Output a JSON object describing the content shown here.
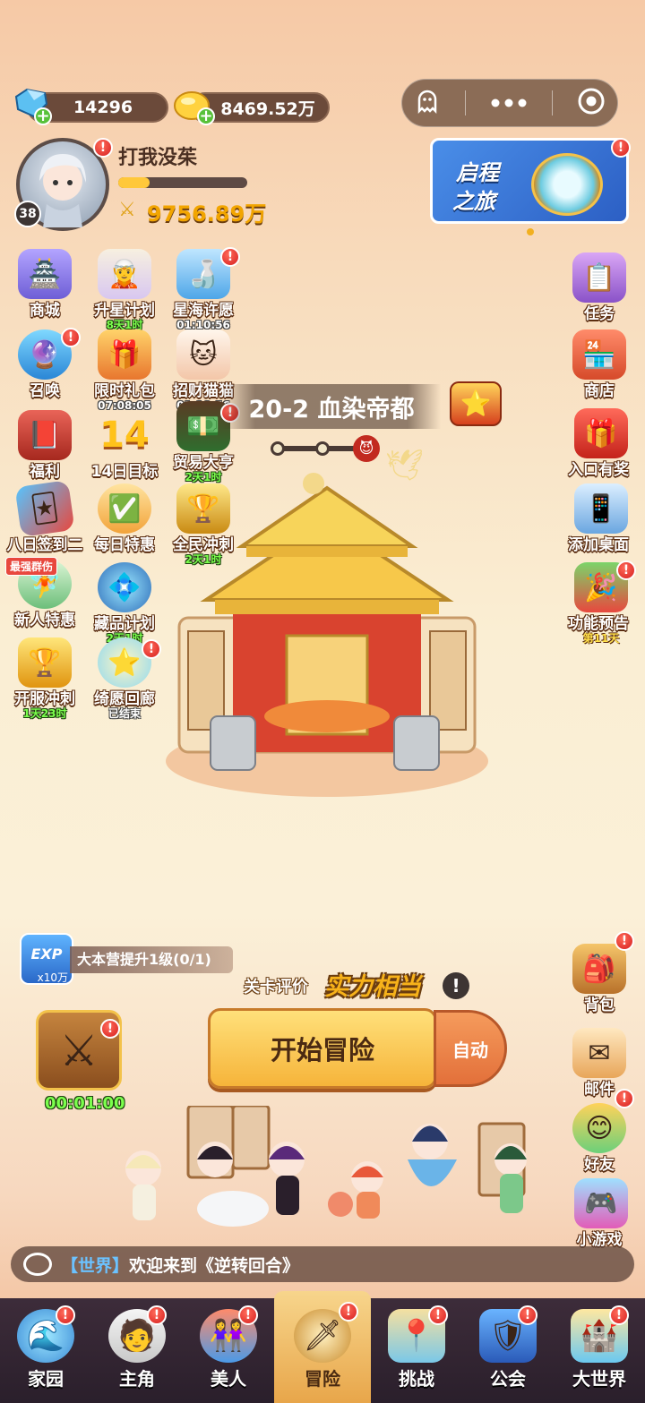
{
  "currency": {
    "gems": "14296",
    "gold": "8469.52万"
  },
  "player": {
    "name": "打我没茱",
    "level": "38",
    "power": "9756.89万"
  },
  "banner": {
    "title_line1": "启程",
    "title_line2": "之旅"
  },
  "left_grid": [
    {
      "label": "商城",
      "timer": ""
    },
    {
      "label": "升星计划",
      "timer": "8天1时"
    },
    {
      "label": "星海许愿",
      "timer": "01:10:56"
    },
    {
      "label": "召唤",
      "timer": ""
    },
    {
      "label": "限时礼包",
      "timer": "07:08:05"
    },
    {
      "label": "招财猫猫",
      "timer": "01:10:56"
    },
    {
      "label": "福利",
      "timer": ""
    },
    {
      "label": "14日目标",
      "timer": ""
    },
    {
      "label": "贸易大亨",
      "timer": "2天1时"
    },
    {
      "label": "八日签到二",
      "timer": ""
    },
    {
      "label": "每日特惠",
      "timer": ""
    },
    {
      "label": "全民冲刺",
      "timer": "2天1时"
    },
    {
      "label": "新人特惠",
      "timer": "",
      "tag": "最强群伤"
    },
    {
      "label": "藏品计划",
      "timer": "2天1时"
    },
    {
      "label": "开服冲刺",
      "timer": "1天23时"
    },
    {
      "label": "绮愿回廊",
      "timer": "已结束"
    }
  ],
  "right_col": [
    {
      "label": "任务",
      "timer": ""
    },
    {
      "label": "商店",
      "timer": ""
    },
    {
      "label": "入口有奖",
      "timer": ""
    },
    {
      "label": "添加桌面",
      "timer": ""
    },
    {
      "label": "功能预告",
      "timer": "第11天"
    }
  ],
  "right_lower": [
    {
      "label": "背包"
    },
    {
      "label": "邮件"
    },
    {
      "label": "好友"
    },
    {
      "label": "小游戏"
    }
  ],
  "stage": {
    "title": "20-2 血染帝都"
  },
  "quest": {
    "exp_badge": "EXP",
    "exp_amount": "x10万",
    "text": "大本营提升1级(0/1)"
  },
  "rating": {
    "label": "关卡评价",
    "value": "实力相当"
  },
  "battle": {
    "start_label": "开始冒险",
    "auto_label": "自动",
    "idle_timer": "00:01:00"
  },
  "chat": {
    "channel": "【世界】",
    "message": "欢迎来到《逆转回合》"
  },
  "nav": [
    {
      "label": "家园"
    },
    {
      "label": "主角"
    },
    {
      "label": "美人"
    },
    {
      "label": "冒险"
    },
    {
      "label": "挑战"
    },
    {
      "label": "公会"
    },
    {
      "label": "大世界"
    }
  ],
  "colors": {
    "timer_green": "#7bff4d",
    "badge_red": "#d61f1f",
    "gold_text": "#f2a500"
  }
}
